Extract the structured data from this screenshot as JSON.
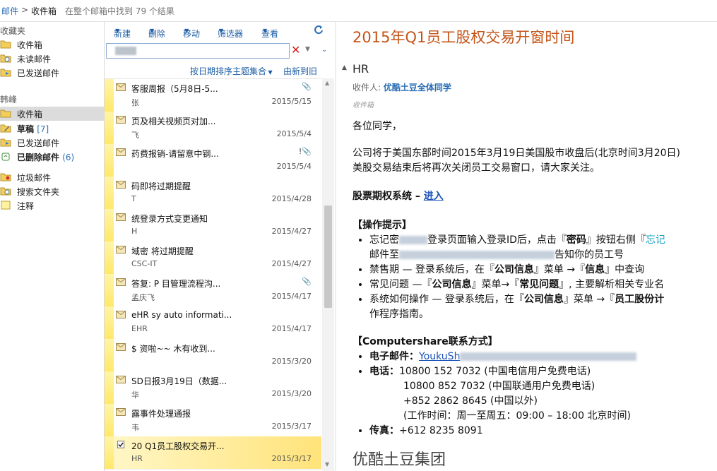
{
  "breadcrumb": {
    "root": "邮件",
    "sep": ">",
    "current": "收件箱",
    "info": "在整个邮箱中找到 79 个结果"
  },
  "folders": {
    "fav_header": "收藏夹",
    "fav": [
      {
        "label": "收件箱"
      },
      {
        "label": "未读邮件"
      },
      {
        "label": "已发送邮件"
      }
    ],
    "acct_header": "韩峰",
    "acct": [
      {
        "label": "收件箱"
      },
      {
        "label": "草稿",
        "count": "[7]"
      },
      {
        "label": "已发送邮件"
      },
      {
        "label": "已删除邮件",
        "count": "(6)"
      },
      {
        "label": "垃圾邮件"
      },
      {
        "label": "搜索文件夹"
      },
      {
        "label": "注释"
      }
    ]
  },
  "toolbar": {
    "new": "新建",
    "delete": "删除",
    "move": "移动",
    "filter": "筛选器",
    "view": "查看"
  },
  "sort": {
    "by": "按日期排序主题集合",
    "order": "由新到旧"
  },
  "messages": [
    {
      "subj": "客服周报（5月8日-5...",
      "from": "张",
      "date": "2015/5/15",
      "att": "📎"
    },
    {
      "subj": "页及相关视频页对加...",
      "from": "飞",
      "date": "2015/5/4",
      "att": ""
    },
    {
      "subj": "药费报销-请留意中钢...",
      "from": "",
      "date": "2015/5/4",
      "att": "!📎"
    },
    {
      "subj": "码即将过期提醒",
      "from": "T",
      "date": "2015/4/28",
      "att": ""
    },
    {
      "subj": "统登录方式变更通知",
      "from": "H",
      "date": "2015/4/27",
      "att": ""
    },
    {
      "subj": "域密 将过期提醒",
      "from": "CSC-IT",
      "date": "2015/4/27",
      "att": ""
    },
    {
      "subj": "答复: P 目管理流程沟...",
      "from": "孟庆飞",
      "date": "2015/4/17",
      "att": "📎"
    },
    {
      "subj": "eHR sy auto informati...",
      "from": "EHR",
      "date": "2015/4/17",
      "att": ""
    },
    {
      "subj": "$ 资啦~~ 木有收到...",
      "from": "",
      "date": "2015/3/20",
      "att": ""
    },
    {
      "subj": "SD日报3月19日（数据...",
      "from": "华",
      "date": "2015/3/20",
      "att": ""
    },
    {
      "subj": "露事件处理通报",
      "from": "韦",
      "date": "2015/3/17",
      "att": ""
    },
    {
      "subj": "20 Q1员工股权交易开...",
      "from": "HR",
      "date": "2015/3/17",
      "att": ""
    }
  ],
  "email": {
    "title": "2015年Q1员工股权交易开窗时间",
    "from": "HR",
    "to_label": "收件人:",
    "to": "优酷土豆全体同学",
    "fold": "收件箱",
    "greeting": "各位同学，",
    "p1a": "公司将于美国东部时间2015年3月19日美国股市收盘后(北京时间3月20日)",
    "p1b": "美股交易结束后将再次关闭员工交易窗口，请大家关注。",
    "sys_label": "股票期权系统 – ",
    "sys_link": "进入",
    "ops_head": "【操作提示】",
    "op1a": "忘记密",
    "op1b": "登录页面输入登录ID后，点击『",
    "op1c": "密码",
    "op1d": "』按钮右侧『",
    "op1e": "忘记",
    "op1f": "邮件至",
    "op1g": "告知你的员工号",
    "op2a": "禁售期 — 登录系统后，在『",
    "op2b": "公司信息",
    "op2c": "』菜单 →『",
    "op2d": "信息",
    "op2e": "』中查询",
    "op3a": "常见问题 —『",
    "op3b": "公司信息",
    "op3c": "』菜单→『",
    "op3d": "常见问题",
    "op3e": "』, 主要解析相关专业名",
    "op4a": "系统如何操作 — 登录系统后，在『",
    "op4b": "公司信息",
    "op4c": "』菜单 →『",
    "op4d": "员工股份计",
    "op4e": "作程序指南。",
    "cs_head": "【Computershare联系方式】",
    "email_label": "电子邮件：",
    "email_link": "YoukuSh",
    "phone_label": "电话：",
    "phone1": "10800 152 7032 (中国电信用户免费电话)",
    "phone2": "10800 852 7032 (中国联通用户免费电话)",
    "phone3": "+852 2862 8645 (中国以外)",
    "phone4": "(工作时间：周一至周五：09:00 – 18:00 北京时间)",
    "fax_label": "传真：",
    "fax": "+612 8235 8091",
    "sign": "优酷土豆集团"
  }
}
